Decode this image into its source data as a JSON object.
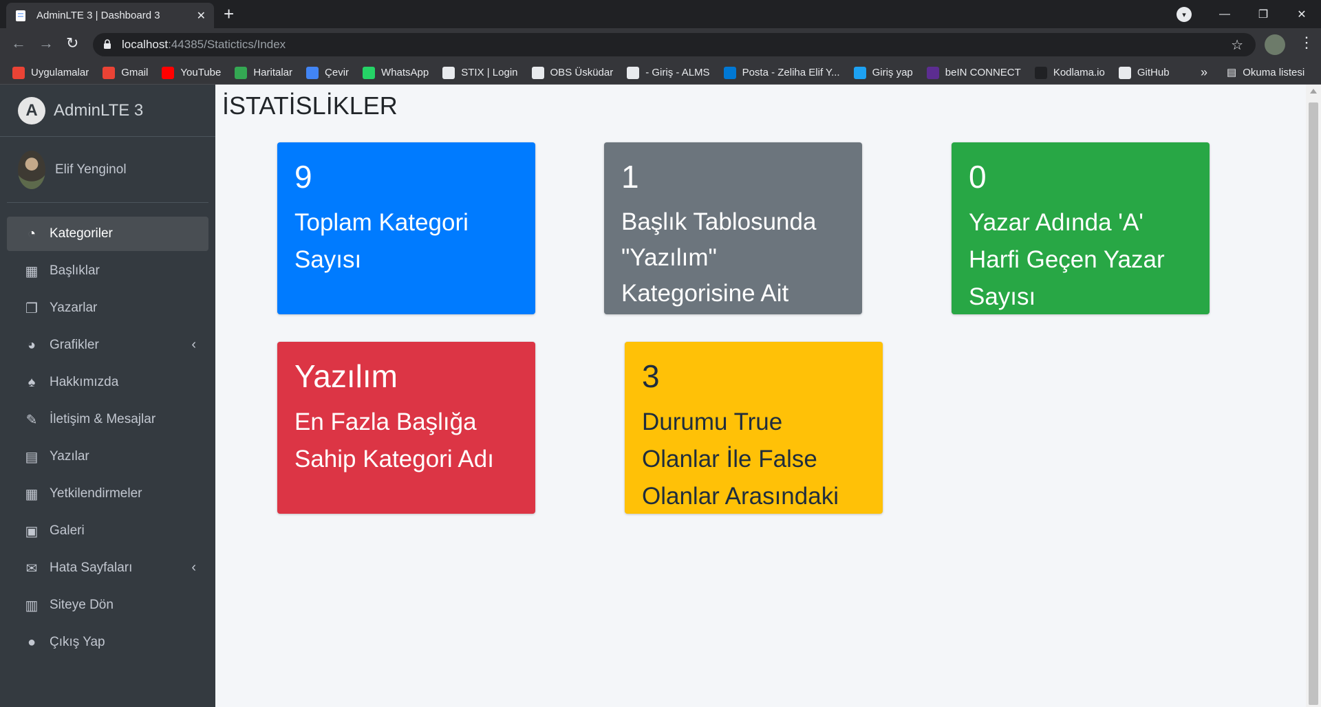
{
  "browser": {
    "tab_title": "AdminLTE 3 | Dashboard 3",
    "tab_close": "✕",
    "new_tab": "+",
    "url_host": "localhost",
    "url_path": ":44385/Statictics/Index",
    "bookmarks": [
      {
        "label": "Uygulamalar",
        "color": "#ea4335"
      },
      {
        "label": "Gmail",
        "color": "#ea4335"
      },
      {
        "label": "YouTube",
        "color": "#ff0000"
      },
      {
        "label": "Haritalar",
        "color": "#34a853"
      },
      {
        "label": "Çevir",
        "color": "#4285f4"
      },
      {
        "label": "WhatsApp",
        "color": "#25d366"
      },
      {
        "label": "STIX | Login",
        "color": "#e8eaed"
      },
      {
        "label": "OBS Üsküdar",
        "color": "#e8eaed"
      },
      {
        "label": "- Giriş - ALMS",
        "color": "#e8eaed"
      },
      {
        "label": "Posta - Zeliha Elif Y...",
        "color": "#0078d4"
      },
      {
        "label": "Giriş yap",
        "color": "#1da1f2"
      },
      {
        "label": "beIN CONNECT",
        "color": "#5c2d91"
      },
      {
        "label": "Kodlama.io",
        "color": "#202124"
      },
      {
        "label": "GitHub",
        "color": "#e8eaed"
      }
    ],
    "bookmarks_more": "»",
    "reading_list": "Okuma listesi"
  },
  "sidebar": {
    "brand": "AdminLTE 3",
    "brand_logo": "A",
    "user_name": "Elif Yenginol",
    "items": [
      {
        "label": "Kategoriler",
        "icon": "tachometer-icon",
        "glyph": "◔"
      },
      {
        "label": "Başlıklar",
        "icon": "grid-icon",
        "glyph": "▦"
      },
      {
        "label": "Yazarlar",
        "icon": "copy-icon",
        "glyph": "❐"
      },
      {
        "label": "Grafikler",
        "icon": "pie-chart-icon",
        "glyph": "◕"
      },
      {
        "label": "Hakkımızda",
        "icon": "tree-icon",
        "glyph": "♠"
      },
      {
        "label": "İletişim & Mesajlar",
        "icon": "edit-icon",
        "glyph": "✎"
      },
      {
        "label": "Yazılar",
        "icon": "table-icon",
        "glyph": "▤"
      },
      {
        "label": "Yetkilendirmeler",
        "icon": "calendar-icon",
        "glyph": "▦"
      },
      {
        "label": "Galeri",
        "icon": "image-icon",
        "glyph": "▣"
      },
      {
        "label": "Hata Sayfaları",
        "icon": "envelope-icon",
        "glyph": "✉"
      },
      {
        "label": "Siteye Dön",
        "icon": "book-icon",
        "glyph": "▥"
      },
      {
        "label": "Çıkış Yap",
        "icon": "apple-icon",
        "glyph": "●"
      }
    ],
    "chevron": "‹"
  },
  "main": {
    "title": "İSTATİSLİKLER",
    "boxes": [
      {
        "value": "9",
        "label": "Toplam Kategori Sayısı"
      },
      {
        "value": "1",
        "label": "Başlık Tablosunda \"Yazılım\" Kategorisine Ait Başlık Sayısı"
      },
      {
        "value": "0",
        "label": "Yazar Adında 'A' Harfi Geçen Yazar Sayısı"
      },
      {
        "value": "Yazılım",
        "label": "En Fazla Başlığa Sahip Kategori Adı"
      },
      {
        "value": "3",
        "label": "Durumu True Olanlar İle False Olanlar Arasındaki Fark"
      }
    ]
  },
  "colors": {
    "primary": "#007bff",
    "secondary": "#6c757d",
    "success": "#28a745",
    "danger": "#dc3545",
    "warning": "#ffc107"
  }
}
